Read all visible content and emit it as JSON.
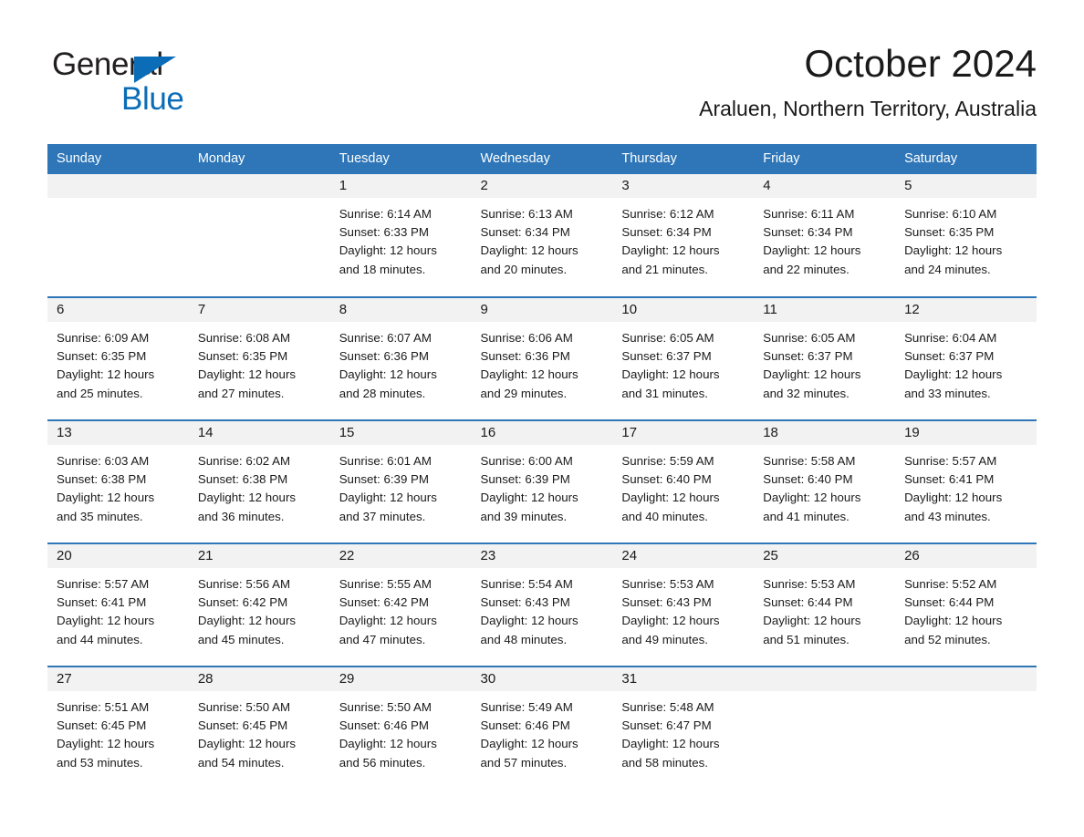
{
  "brand": {
    "name_part1": "General",
    "name_part2": "Blue",
    "color_dark": "#231f20",
    "color_blue": "#0b6cb7"
  },
  "header": {
    "month_title": "October 2024",
    "location": "Araluen, Northern Territory, Australia"
  },
  "theme": {
    "header_blue": "#2e76b8",
    "daynum_band": "#f2f2f2",
    "text": "#1a1a1a"
  },
  "weekday_headers": [
    "Sunday",
    "Monday",
    "Tuesday",
    "Wednesday",
    "Thursday",
    "Friday",
    "Saturday"
  ],
  "weeks": [
    [
      {
        "day": "",
        "lines": []
      },
      {
        "day": "",
        "lines": []
      },
      {
        "day": "1",
        "lines": [
          "Sunrise: 6:14 AM",
          "Sunset: 6:33 PM",
          "Daylight: 12 hours",
          "and 18 minutes."
        ]
      },
      {
        "day": "2",
        "lines": [
          "Sunrise: 6:13 AM",
          "Sunset: 6:34 PM",
          "Daylight: 12 hours",
          "and 20 minutes."
        ]
      },
      {
        "day": "3",
        "lines": [
          "Sunrise: 6:12 AM",
          "Sunset: 6:34 PM",
          "Daylight: 12 hours",
          "and 21 minutes."
        ]
      },
      {
        "day": "4",
        "lines": [
          "Sunrise: 6:11 AM",
          "Sunset: 6:34 PM",
          "Daylight: 12 hours",
          "and 22 minutes."
        ]
      },
      {
        "day": "5",
        "lines": [
          "Sunrise: 6:10 AM",
          "Sunset: 6:35 PM",
          "Daylight: 12 hours",
          "and 24 minutes."
        ]
      }
    ],
    [
      {
        "day": "6",
        "lines": [
          "Sunrise: 6:09 AM",
          "Sunset: 6:35 PM",
          "Daylight: 12 hours",
          "and 25 minutes."
        ]
      },
      {
        "day": "7",
        "lines": [
          "Sunrise: 6:08 AM",
          "Sunset: 6:35 PM",
          "Daylight: 12 hours",
          "and 27 minutes."
        ]
      },
      {
        "day": "8",
        "lines": [
          "Sunrise: 6:07 AM",
          "Sunset: 6:36 PM",
          "Daylight: 12 hours",
          "and 28 minutes."
        ]
      },
      {
        "day": "9",
        "lines": [
          "Sunrise: 6:06 AM",
          "Sunset: 6:36 PM",
          "Daylight: 12 hours",
          "and 29 minutes."
        ]
      },
      {
        "day": "10",
        "lines": [
          "Sunrise: 6:05 AM",
          "Sunset: 6:37 PM",
          "Daylight: 12 hours",
          "and 31 minutes."
        ]
      },
      {
        "day": "11",
        "lines": [
          "Sunrise: 6:05 AM",
          "Sunset: 6:37 PM",
          "Daylight: 12 hours",
          "and 32 minutes."
        ]
      },
      {
        "day": "12",
        "lines": [
          "Sunrise: 6:04 AM",
          "Sunset: 6:37 PM",
          "Daylight: 12 hours",
          "and 33 minutes."
        ]
      }
    ],
    [
      {
        "day": "13",
        "lines": [
          "Sunrise: 6:03 AM",
          "Sunset: 6:38 PM",
          "Daylight: 12 hours",
          "and 35 minutes."
        ]
      },
      {
        "day": "14",
        "lines": [
          "Sunrise: 6:02 AM",
          "Sunset: 6:38 PM",
          "Daylight: 12 hours",
          "and 36 minutes."
        ]
      },
      {
        "day": "15",
        "lines": [
          "Sunrise: 6:01 AM",
          "Sunset: 6:39 PM",
          "Daylight: 12 hours",
          "and 37 minutes."
        ]
      },
      {
        "day": "16",
        "lines": [
          "Sunrise: 6:00 AM",
          "Sunset: 6:39 PM",
          "Daylight: 12 hours",
          "and 39 minutes."
        ]
      },
      {
        "day": "17",
        "lines": [
          "Sunrise: 5:59 AM",
          "Sunset: 6:40 PM",
          "Daylight: 12 hours",
          "and 40 minutes."
        ]
      },
      {
        "day": "18",
        "lines": [
          "Sunrise: 5:58 AM",
          "Sunset: 6:40 PM",
          "Daylight: 12 hours",
          "and 41 minutes."
        ]
      },
      {
        "day": "19",
        "lines": [
          "Sunrise: 5:57 AM",
          "Sunset: 6:41 PM",
          "Daylight: 12 hours",
          "and 43 minutes."
        ]
      }
    ],
    [
      {
        "day": "20",
        "lines": [
          "Sunrise: 5:57 AM",
          "Sunset: 6:41 PM",
          "Daylight: 12 hours",
          "and 44 minutes."
        ]
      },
      {
        "day": "21",
        "lines": [
          "Sunrise: 5:56 AM",
          "Sunset: 6:42 PM",
          "Daylight: 12 hours",
          "and 45 minutes."
        ]
      },
      {
        "day": "22",
        "lines": [
          "Sunrise: 5:55 AM",
          "Sunset: 6:42 PM",
          "Daylight: 12 hours",
          "and 47 minutes."
        ]
      },
      {
        "day": "23",
        "lines": [
          "Sunrise: 5:54 AM",
          "Sunset: 6:43 PM",
          "Daylight: 12 hours",
          "and 48 minutes."
        ]
      },
      {
        "day": "24",
        "lines": [
          "Sunrise: 5:53 AM",
          "Sunset: 6:43 PM",
          "Daylight: 12 hours",
          "and 49 minutes."
        ]
      },
      {
        "day": "25",
        "lines": [
          "Sunrise: 5:53 AM",
          "Sunset: 6:44 PM",
          "Daylight: 12 hours",
          "and 51 minutes."
        ]
      },
      {
        "day": "26",
        "lines": [
          "Sunrise: 5:52 AM",
          "Sunset: 6:44 PM",
          "Daylight: 12 hours",
          "and 52 minutes."
        ]
      }
    ],
    [
      {
        "day": "27",
        "lines": [
          "Sunrise: 5:51 AM",
          "Sunset: 6:45 PM",
          "Daylight: 12 hours",
          "and 53 minutes."
        ]
      },
      {
        "day": "28",
        "lines": [
          "Sunrise: 5:50 AM",
          "Sunset: 6:45 PM",
          "Daylight: 12 hours",
          "and 54 minutes."
        ]
      },
      {
        "day": "29",
        "lines": [
          "Sunrise: 5:50 AM",
          "Sunset: 6:46 PM",
          "Daylight: 12 hours",
          "and 56 minutes."
        ]
      },
      {
        "day": "30",
        "lines": [
          "Sunrise: 5:49 AM",
          "Sunset: 6:46 PM",
          "Daylight: 12 hours",
          "and 57 minutes."
        ]
      },
      {
        "day": "31",
        "lines": [
          "Sunrise: 5:48 AM",
          "Sunset: 6:47 PM",
          "Daylight: 12 hours",
          "and 58 minutes."
        ]
      },
      {
        "day": "",
        "lines": []
      },
      {
        "day": "",
        "lines": []
      }
    ]
  ]
}
